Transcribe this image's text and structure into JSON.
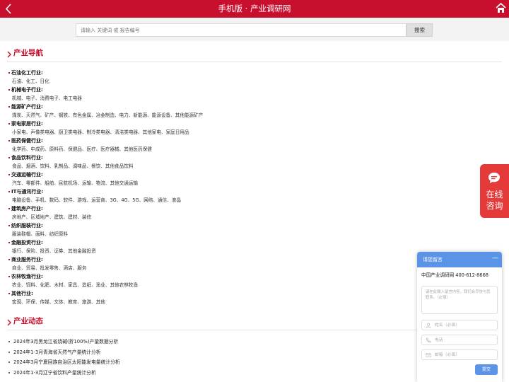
{
  "header": {
    "title": "手机版 · 产业调研网"
  },
  "search": {
    "placeholder": "请输入 关键词 或 报告编号",
    "button_label": "搜索"
  },
  "industry_nav": {
    "heading": "产业导航",
    "categories": [
      {
        "name": "石油化工行业:",
        "subs": "石油、化工、日化"
      },
      {
        "name": "机械电子行业:",
        "subs": "机械、电子、消费电子、电工电器"
      },
      {
        "name": "能源矿产行业:",
        "subs": "煤炭、天然气、矿产、钢铁、有色金属、冶金制造、电力、新能源、能源设备、其他能源矿产"
      },
      {
        "name": "家电家居行业:",
        "subs": "小家电、声像类电器、厨卫类电器、制冷类电器、清洁类电器、其他家电、家庭日用品"
      },
      {
        "name": "医药保健行业:",
        "subs": "化学药、中成药、原料药、保健品、医疗、医疗器械、其他医药保健"
      },
      {
        "name": "食品饮料行业:",
        "subs": "食品、烟酒、饮料、乳制品、调味品、餐饮、其他食品饮料"
      },
      {
        "name": "交通运输行业:",
        "subs": "汽车、零部件、船舶、民航机场、运输、物流、其他交通运输"
      },
      {
        "name": "IT与通讯行业:",
        "subs": "电脑设备、手机、数码、软件、游戏、运营商、3G、4G、5G、网络、通信、液晶"
      },
      {
        "name": "建筑房产行业:",
        "subs": "房地产、区域地产、建筑、建材、装修"
      },
      {
        "name": "纺织服装行业:",
        "subs": "服装鞋帽、面料、纺织原料"
      },
      {
        "name": "金融投资行业:",
        "subs": "银行、保险、投资、证券、其他金融投资"
      },
      {
        "name": "商业服务行业:",
        "subs": "商业、贸易、批发零售、酒店、服务"
      },
      {
        "name": "农林牧渔行业:",
        "subs": "农业、饲料、化肥、木材、家具、造纸、渔业、其他农林牧渔"
      },
      {
        "name": "其他行业:",
        "subs": "宏观、环保、传媒、文体、教育、旅游、其他"
      }
    ]
  },
  "industry_news": {
    "heading": "产业动态",
    "items": [
      "2024年3月黑龙江省烧碱(折100%)产量数据分析",
      "2024年1-3月青海省天然气产量统计分析",
      "2024年3月宁夏回族自治区太阳能发电量统计分析",
      "2024年1-3月辽宁省饮料产量统计分析"
    ]
  },
  "consult": {
    "line1": "在线",
    "line2": "咨询"
  },
  "message_box": {
    "title": "请您留言",
    "minimize": "—",
    "company": "中国产业调研网 400-612-8668",
    "textarea_placeholder": "请在此输入留言内容，我们会尽快与您联系。（必填）",
    "name_placeholder": "姓名（必填）",
    "phone_placeholder": "电话",
    "email_placeholder": "邮箱（必填）",
    "submit_label": "提交"
  },
  "colors": {
    "brand_red": "#c8102e",
    "consult_red": "#e53a3a",
    "dialog_blue": "#5b93e6"
  }
}
